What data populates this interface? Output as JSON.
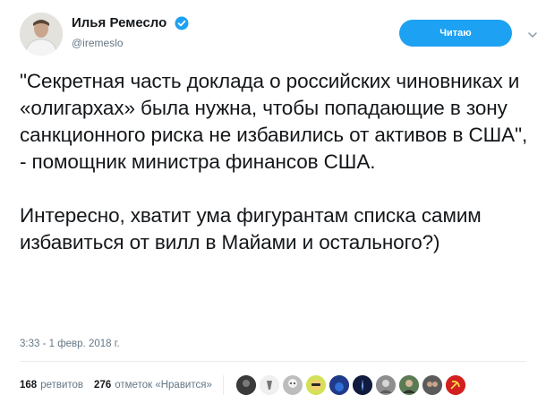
{
  "author": {
    "display_name": "Илья Ремесло",
    "handle": "@iremeslo",
    "verified": true,
    "avatar_icon": "user-avatar-icon"
  },
  "follow_button": {
    "label": "Читаю"
  },
  "tweet": {
    "paragraph_1": "\"Секретная часть доклада о российских чиновниках и «олигархах» была нужна, чтобы попадающие в зону санкционного риска не избавились от активов в США\", - помощник министра финансов США.",
    "paragraph_2": "Интересно, хватит ума фигурантам списка самим избавиться от вилл в Майами и остального?)"
  },
  "timestamp": "3:33 - 1 февр. 2018 г.",
  "stats": {
    "retweets_count": "168",
    "retweets_label": "ретвитов",
    "likes_count": "276",
    "likes_label": "отметок «Нравится»"
  },
  "colors": {
    "accent": "#1da1f2",
    "text": "#14171a",
    "muted": "#657786",
    "border": "#e6ecf0"
  }
}
